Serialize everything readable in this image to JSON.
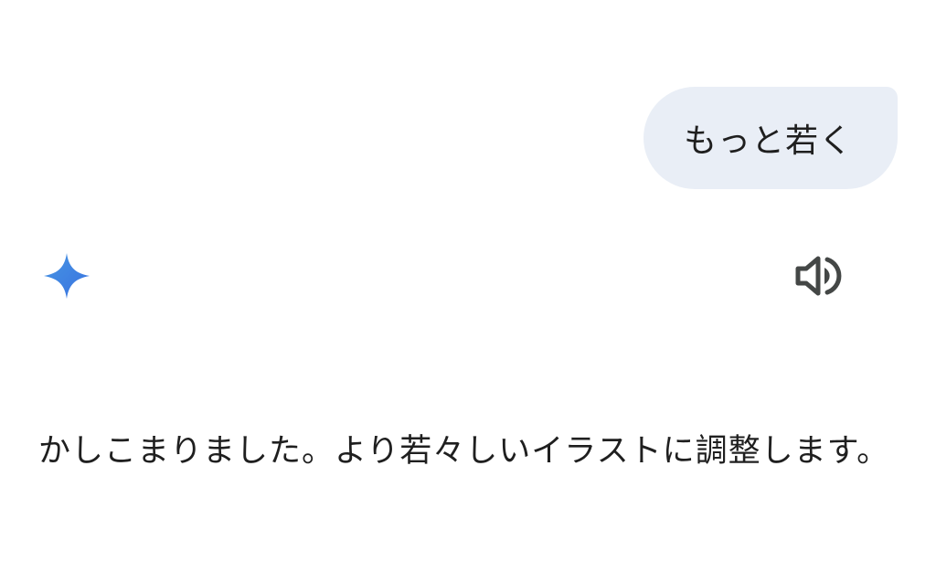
{
  "conversation": {
    "user_message": "もっと若く",
    "assistant": {
      "logo_icon": "gemini-sparkle-icon",
      "speaker_icon": "speaker-volume-icon",
      "response": "かしこまりました。より若々しいイラストに調整します。"
    }
  },
  "colors": {
    "user_bubble_bg": "#e9eef6",
    "text": "#1f1f1f",
    "icon": "#444746",
    "sparkle_gradient": [
      "#4796e3",
      "#3871e0"
    ]
  }
}
